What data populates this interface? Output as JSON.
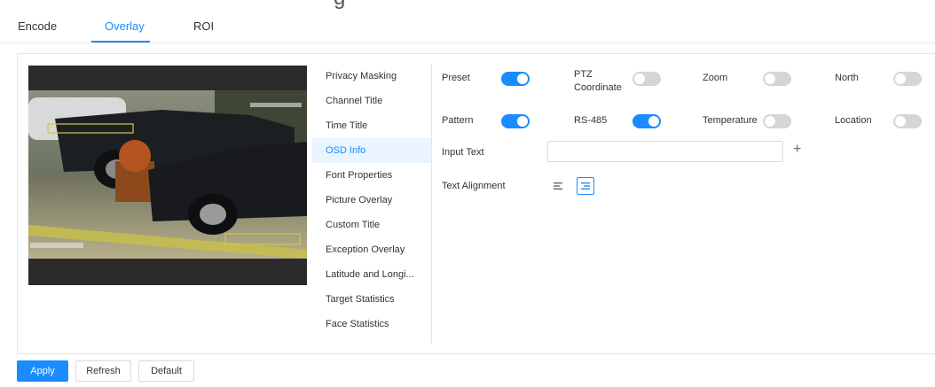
{
  "tabs": [
    {
      "label": "Encode"
    },
    {
      "label": "Overlay"
    },
    {
      "label": "ROI"
    }
  ],
  "active_tab": "Overlay",
  "menu": {
    "items": [
      {
        "label": "Privacy Masking"
      },
      {
        "label": "Channel Title"
      },
      {
        "label": "Time Title"
      },
      {
        "label": "OSD Info"
      },
      {
        "label": "Font Properties"
      },
      {
        "label": "Picture Overlay"
      },
      {
        "label": "Custom Title"
      },
      {
        "label": "Exception Overlay"
      },
      {
        "label": "Latitude and Longi..."
      },
      {
        "label": "Target Statistics"
      },
      {
        "label": "Face Statistics"
      }
    ],
    "active": "OSD Info"
  },
  "osd": {
    "toggles": [
      {
        "label": "Preset",
        "on": true
      },
      {
        "label": "PTZ\nCoordinate",
        "on": false
      },
      {
        "label": "Zoom",
        "on": false
      },
      {
        "label": "North",
        "on": false
      },
      {
        "label": "Pattern",
        "on": true
      },
      {
        "label": "RS-485",
        "on": true
      },
      {
        "label": "Temperature",
        "on": false
      },
      {
        "label": "Location",
        "on": false
      }
    ],
    "input_text_label": "Input Text",
    "input_text_value": "",
    "plus_symbol": "+",
    "text_alignment_label": "Text Alignment",
    "text_alignment_selected": "right"
  },
  "buttons": {
    "apply": "Apply",
    "refresh": "Refresh",
    "default": "Default"
  },
  "colors": {
    "accent": "#1a8cff",
    "toggle_off": "#d5d5d5",
    "active_menu_bg": "#e9f4ff"
  }
}
